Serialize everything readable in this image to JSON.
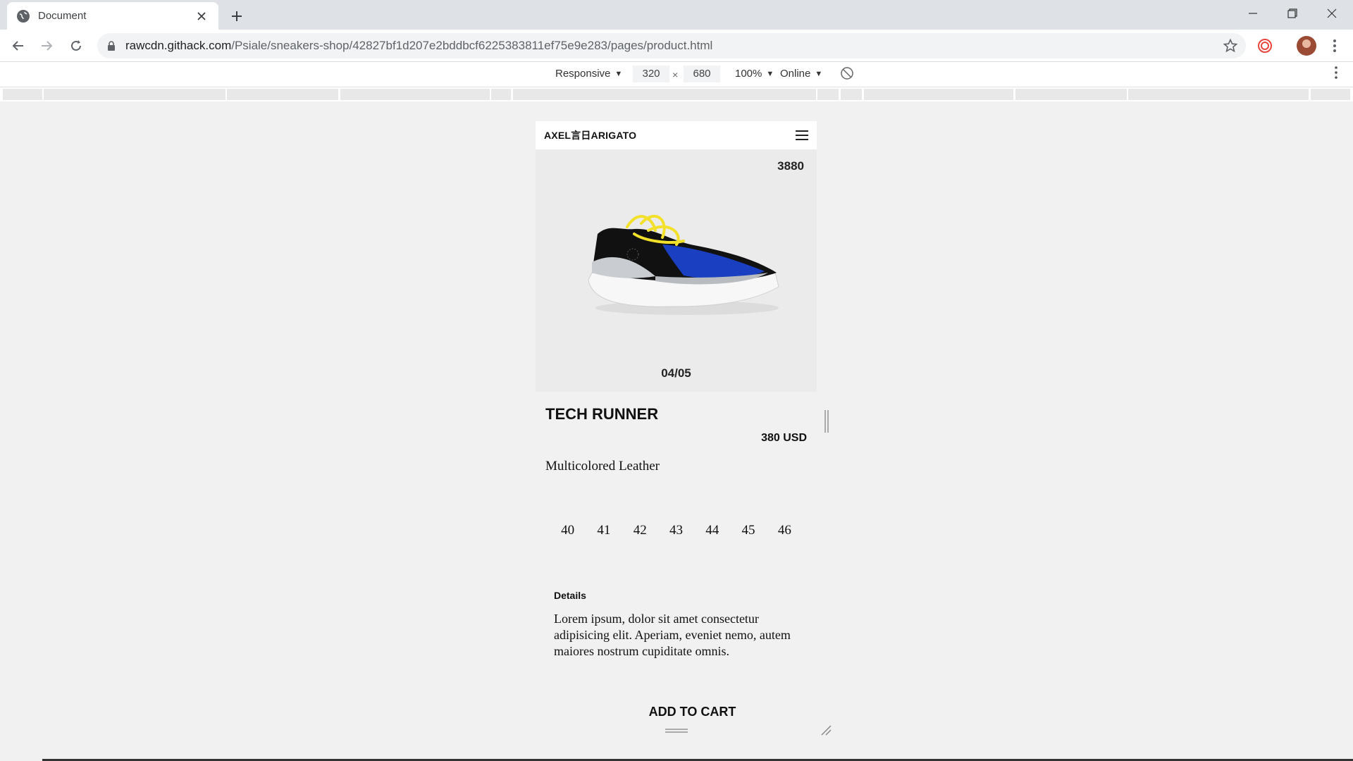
{
  "browser": {
    "tab_title": "Document",
    "url_host": "rawcdn.githack.com",
    "url_path": "/Psiale/sneakers-shop/42827bf1d207e2bddbcf6225383811ef75e9e283/pages/product.html"
  },
  "devtools": {
    "device": "Responsive",
    "width": "320",
    "height": "680",
    "times": "×",
    "zoom": "100%",
    "network": "Online"
  },
  "site": {
    "logo": "AXEL言日ARIGATO",
    "gallery_count": "3880",
    "slide_index": "04/05",
    "product_name": "TECH RUNNER",
    "price": "380 USD",
    "material": "Multicolored Leather",
    "sizes": [
      "40",
      "41",
      "42",
      "43",
      "44",
      "45",
      "46"
    ],
    "details_title": "Details",
    "details_text": "Lorem ipsum, dolor sit amet consectetur adipisicing elit. Aperiam, eveniet nemo, autem maiores nostrum cupiditate omnis.",
    "add_to_cart": "ADD TO CART"
  },
  "colors": {
    "shoe_accent": "#1a3fc0",
    "laces": "#f2e02b"
  }
}
